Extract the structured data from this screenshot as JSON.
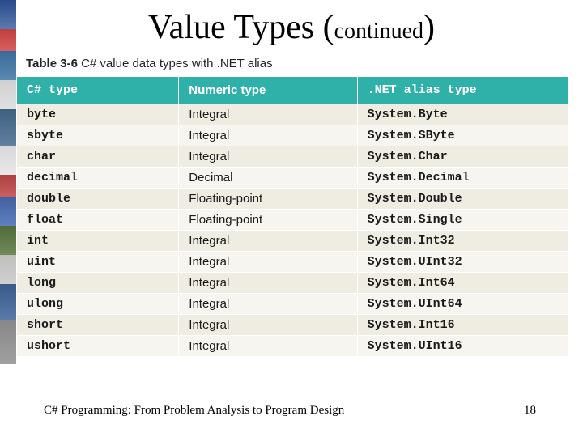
{
  "title_main": "Value Types ",
  "title_paren_open": "(",
  "title_sub": "continued",
  "title_paren_close": ")",
  "caption": {
    "label": "Table 3-6",
    "text": "  C# value data types with .NET alias"
  },
  "headers": {
    "c0": "C# type",
    "c1": "Numeric type",
    "c2": ".NET alias type"
  },
  "rows": [
    {
      "t": "byte",
      "n": "Integral",
      "a": "System.Byte"
    },
    {
      "t": "sbyte",
      "n": "Integral",
      "a": "System.SByte"
    },
    {
      "t": "char",
      "n": "Integral",
      "a": "System.Char"
    },
    {
      "t": "decimal",
      "n": "Decimal",
      "a": "System.Decimal"
    },
    {
      "t": "double",
      "n": "Floating-point",
      "a": "System.Double"
    },
    {
      "t": "float",
      "n": "Floating-point",
      "a": "System.Single"
    },
    {
      "t": "int",
      "n": "Integral",
      "a": "System.Int32"
    },
    {
      "t": "uint",
      "n": "Integral",
      "a": "System.UInt32"
    },
    {
      "t": "long",
      "n": "Integral",
      "a": "System.Int64"
    },
    {
      "t": "ulong",
      "n": "Integral",
      "a": "System.UInt64"
    },
    {
      "t": "short",
      "n": "Integral",
      "a": "System.Int16"
    },
    {
      "t": "ushort",
      "n": "Integral",
      "a": "System.UInt16"
    }
  ],
  "footer": {
    "left": "C# Programming: From Problem Analysis to Program Design",
    "right": "18"
  },
  "chart_data": {
    "type": "table",
    "title": "C# value data types with .NET alias",
    "columns": [
      "C# type",
      "Numeric type",
      ".NET alias type"
    ],
    "rows": [
      [
        "byte",
        "Integral",
        "System.Byte"
      ],
      [
        "sbyte",
        "Integral",
        "System.SByte"
      ],
      [
        "char",
        "Integral",
        "System.Char"
      ],
      [
        "decimal",
        "Decimal",
        "System.Decimal"
      ],
      [
        "double",
        "Floating-point",
        "System.Double"
      ],
      [
        "float",
        "Floating-point",
        "System.Single"
      ],
      [
        "int",
        "Integral",
        "System.Int32"
      ],
      [
        "uint",
        "Integral",
        "System.UInt32"
      ],
      [
        "long",
        "Integral",
        "System.Int64"
      ],
      [
        "ulong",
        "Integral",
        "System.UInt64"
      ],
      [
        "short",
        "Integral",
        "System.Int16"
      ],
      [
        "ushort",
        "Integral",
        "System.UInt16"
      ]
    ]
  }
}
